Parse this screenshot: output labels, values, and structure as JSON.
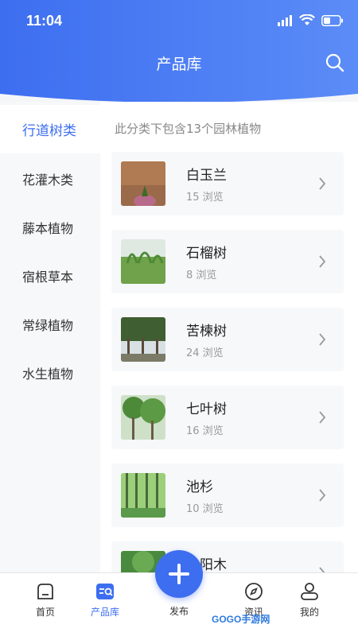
{
  "status_bar": {
    "time": "11:04"
  },
  "header": {
    "title": "产品库"
  },
  "sidebar": {
    "items": [
      {
        "label": "行道树类",
        "active": true
      },
      {
        "label": "花灌木类"
      },
      {
        "label": "藤本植物"
      },
      {
        "label": "宿根草本"
      },
      {
        "label": "常绿植物"
      },
      {
        "label": "水生植物"
      }
    ]
  },
  "content": {
    "summary": "此分类下包含13个园林植物",
    "products": [
      {
        "name": "白玉兰",
        "views": "15 浏览",
        "thumb_color": "#9a6a4a"
      },
      {
        "name": "石榴树",
        "views": "8 浏览",
        "thumb_color": "#6fa24a"
      },
      {
        "name": "苦楝树",
        "views": "24 浏览",
        "thumb_color": "#4a6a3a"
      },
      {
        "name": "七叶树",
        "views": "16 浏览",
        "thumb_color": "#4c8a3a"
      },
      {
        "name": "池杉",
        "views": "10 浏览",
        "thumb_color": "#5a9a4a"
      },
      {
        "name": "…阳木",
        "views": "",
        "thumb_color": "#4a8a3e"
      }
    ]
  },
  "tabbar": {
    "items": [
      {
        "label": "首页",
        "icon": "home-icon"
      },
      {
        "label": "产品库",
        "icon": "product-library-icon",
        "active": true
      },
      {
        "label": "发布",
        "icon": "plus-icon"
      },
      {
        "label": "资讯",
        "icon": "compass-icon"
      },
      {
        "label": "我的",
        "icon": "profile-icon"
      }
    ]
  },
  "watermark": "GOGO手游网",
  "colors": {
    "accent": "#3d6ef0",
    "header_gradient_start": "#3d6ef0",
    "header_gradient_end": "#5b8cf7"
  }
}
